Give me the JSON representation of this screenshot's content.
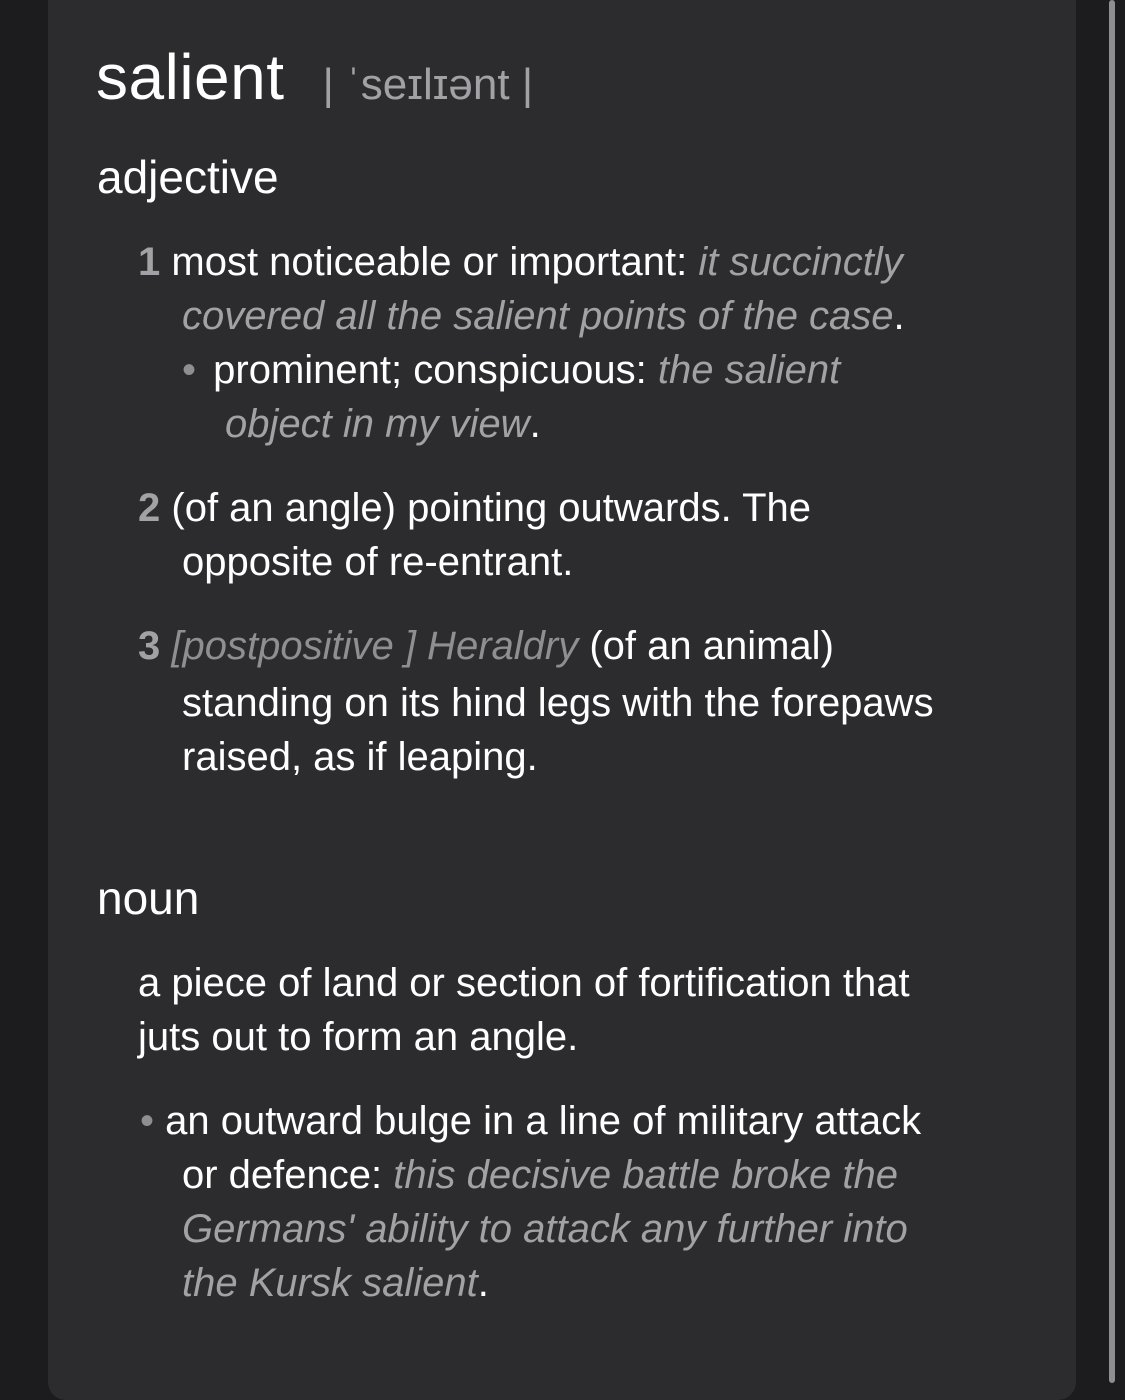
{
  "entry": {
    "headword": "salient",
    "pronunciation": "| ˈseɪlɪənt |"
  },
  "adjective": {
    "pos_label": "adjective",
    "senses": [
      {
        "number": "1",
        "definition": "most noticeable or important:",
        "example_part1": "it succinctly",
        "example_part2": "covered all the salient points of the case",
        "end": ".",
        "subsense": {
          "bullet": "•",
          "definition": "prominent; conspicuous:",
          "example_part1": "the salient",
          "example_part2": "object in my view",
          "end": "."
        }
      },
      {
        "number": "2",
        "line1": "(of an angle) pointing outwards. The",
        "line2_prefix": "opposite of ",
        "cross_ref": "re-entrant",
        "end": "."
      },
      {
        "number": "3",
        "label": "[postpositive ] Heraldry",
        "line1_rest": " (of an animal)",
        "line2": "standing on its hind legs with the forepaws",
        "line3": "raised, as if leaping."
      }
    ]
  },
  "noun": {
    "pos_label": "noun",
    "sense": {
      "line1": "a piece of land or section of fortification that",
      "line2": "juts out to form an angle."
    },
    "subsense": {
      "bullet": "•",
      "line1": " an outward bulge in a line of military attack",
      "line2_def": "or defence:",
      "line2_ex": " this decisive battle broke the",
      "line3_ex": "Germans' ability to attack any further into",
      "line4_ex": "the Kursk salient",
      "end": "."
    }
  }
}
